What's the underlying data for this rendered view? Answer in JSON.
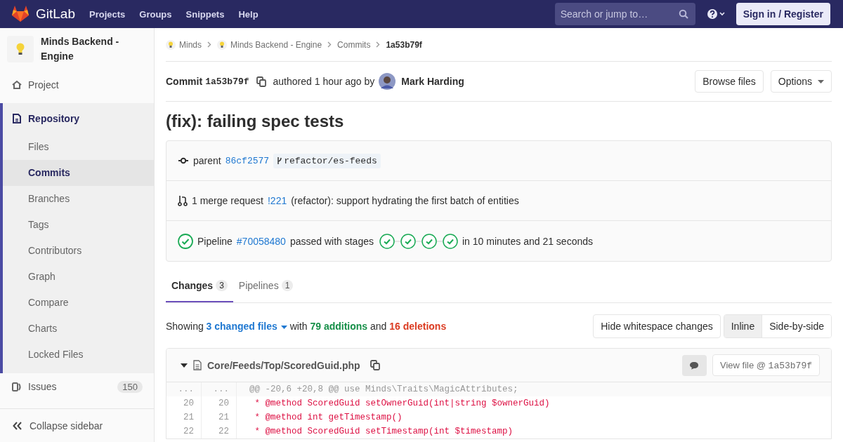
{
  "nav": {
    "brand": "GitLab",
    "links": [
      "Projects",
      "Groups",
      "Snippets",
      "Help"
    ],
    "search": {
      "placeholder": "Search or jump to…"
    },
    "sign_in": "Sign in / Register"
  },
  "sidebar": {
    "project_name": "Minds Backend - Engine",
    "sections": [
      {
        "label": "Project",
        "kind": "project",
        "selected": false
      },
      {
        "label": "Repository",
        "kind": "repository",
        "selected": true,
        "children": [
          {
            "label": "Files",
            "selected": false
          },
          {
            "label": "Commits",
            "selected": true
          },
          {
            "label": "Branches",
            "selected": false
          },
          {
            "label": "Tags",
            "selected": false
          },
          {
            "label": "Contributors",
            "selected": false
          },
          {
            "label": "Graph",
            "selected": false
          },
          {
            "label": "Compare",
            "selected": false
          },
          {
            "label": "Charts",
            "selected": false
          },
          {
            "label": "Locked Files",
            "selected": false
          }
        ]
      },
      {
        "label": "Issues",
        "kind": "issues",
        "selected": false,
        "count": "150"
      }
    ],
    "collapse": "Collapse sidebar"
  },
  "breadcrumbs": [
    {
      "label": "Minds",
      "kind": "group"
    },
    {
      "label": "Minds Backend - Engine",
      "kind": "group"
    },
    {
      "label": "Commits",
      "kind": "link"
    },
    {
      "label": "1a53b79f",
      "kind": "current"
    }
  ],
  "commit": {
    "label": "Commit",
    "sha": "1a53b79f",
    "authored": "authored 1 hour ago by",
    "author": "Mark Harding",
    "buttons": [
      {
        "label": "Browse files",
        "dropdown": false
      },
      {
        "label": "Options",
        "dropdown": true
      }
    ]
  },
  "title": "(fix): failing spec tests",
  "info": {
    "parent": {
      "label": "parent",
      "sha": "86cf2577",
      "branch": "refactor/es-feeds"
    },
    "merge_request": {
      "label": "1 merge request",
      "ref": "!221",
      "title": "(refactor): support hydrating the first batch of entities"
    },
    "pipeline": {
      "label": "Pipeline",
      "ref": "#70058480",
      "status": "passed with stages",
      "stages": [
        {
          "passed": true
        },
        {
          "passed": true
        },
        {
          "passed": true
        },
        {
          "passed": true
        }
      ],
      "duration": "in 10 minutes and 21 seconds"
    }
  },
  "tabs": [
    {
      "label": "Changes",
      "count": "3",
      "selected": true
    },
    {
      "label": "Pipelines",
      "count": "1",
      "selected": false
    }
  ],
  "summary": {
    "showing": "Showing",
    "files": "3 changed files",
    "with": "with",
    "additions": "79 additions",
    "and": "and",
    "deletions": "16 deletions"
  },
  "diff_controls": {
    "whitespace": "Hide whitespace changes",
    "views": [
      {
        "label": "Inline",
        "selected": true
      },
      {
        "label": "Side-by-side",
        "selected": false
      }
    ]
  },
  "file": {
    "path": "Core/Feeds/Top/ScoredGuid.php",
    "expanded": true,
    "view_file": "View file @",
    "sha": "1a53b79f",
    "lines": [
      {
        "kind": "hunk",
        "old": "...",
        "new": "...",
        "code": "@@ -20,6 +20,8 @@ use Minds\\Traits\\MagicAttributes;"
      },
      {
        "kind": "context",
        "old": "20",
        "new": "20",
        "code": " * @method ScoredGuid setOwnerGuid(int|string $ownerGuid)"
      },
      {
        "kind": "context",
        "old": "21",
        "new": "21",
        "code": " * @method int getTimestamp()"
      },
      {
        "kind": "context",
        "old": "22",
        "new": "22",
        "code": " * @method ScoredGuid setTimestamp(int $timestamp)"
      }
    ]
  }
}
